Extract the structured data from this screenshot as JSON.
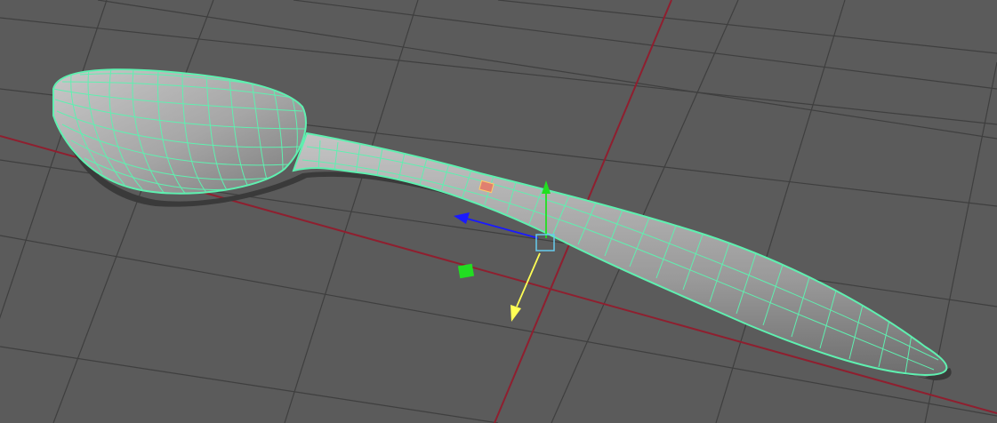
{
  "viewport": {
    "background_color": "#5b5b5b",
    "grid_color": "#3f3f3f",
    "axis_color": "#8f1f2f",
    "camera": "perspective"
  },
  "scene": {
    "object": "spoon",
    "selection_highlight": "#5ff0b0",
    "mesh_shade_light": "#bdbdbd",
    "mesh_shade_dark": "#6c6c6c",
    "display_mode": "wireframe-on-shaded"
  },
  "manipulator": {
    "tool": "move",
    "x_axis_color": "#ffff55",
    "y_axis_color": "#20e020",
    "z_axis_color": "#1a1aff",
    "center_color": "#66ccee",
    "plane_handle_color": "#22dd22"
  }
}
